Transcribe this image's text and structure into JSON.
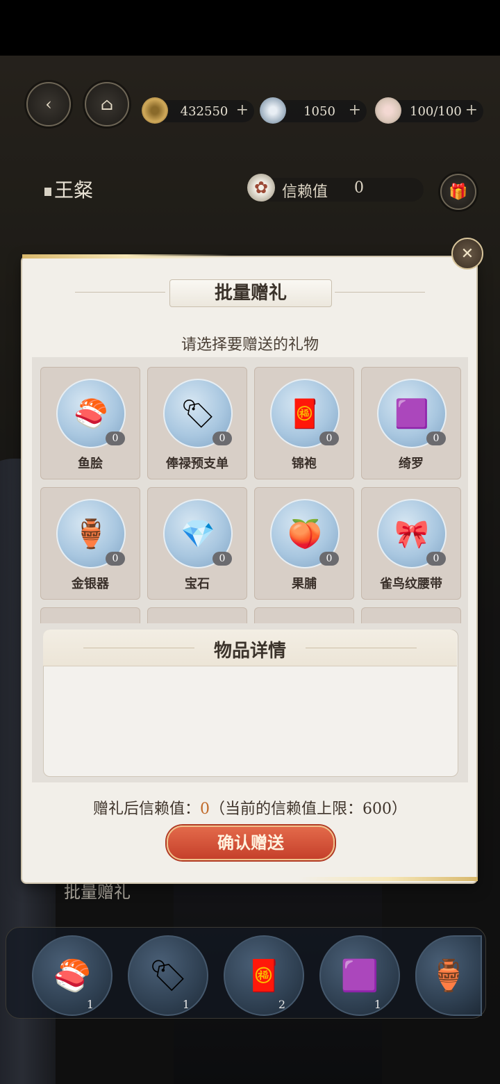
{
  "resources": [
    {
      "icon": "coin-icon",
      "value": "432550"
    },
    {
      "icon": "silver-icon",
      "value": "1050"
    },
    {
      "icon": "food-bowl-icon",
      "value": "100/100"
    }
  ],
  "plus_symbol": "+",
  "character": {
    "name": "王粲",
    "trust_label": "信赖值",
    "trust_value": "0"
  },
  "dialog": {
    "title": "批量赠礼",
    "subtitle": "请选择要赠送的礼物",
    "items": [
      {
        "name": "鱼脍",
        "count": "0",
        "icon": "fish-dish-icon",
        "glyph": "🍣"
      },
      {
        "name": "俸禄预支单",
        "count": "0",
        "icon": "wooden-tag-icon",
        "glyph": "🏷"
      },
      {
        "name": "锦袍",
        "count": "0",
        "icon": "red-robe-icon",
        "glyph": "🧧"
      },
      {
        "name": "绮罗",
        "count": "0",
        "icon": "silk-cloth-icon",
        "glyph": "🟪"
      },
      {
        "name": "金银器",
        "count": "0",
        "icon": "metal-ware-icon",
        "glyph": "🏺"
      },
      {
        "name": "宝石",
        "count": "0",
        "icon": "gem-box-icon",
        "glyph": "💎"
      },
      {
        "name": "果脯",
        "count": "0",
        "icon": "dried-fruit-icon",
        "glyph": "🍑"
      },
      {
        "name": "雀鸟纹腰带",
        "count": "0",
        "icon": "belt-icon",
        "glyph": "🎀"
      }
    ],
    "detail_title": "物品详情",
    "after_trust_prefix": "赠礼后信赖值：",
    "after_trust_value": "0",
    "after_trust_suffix": "（当前的信赖值上限：600）",
    "confirm_label": "确认赠送"
  },
  "bottom": {
    "tab_label": "批量赠礼",
    "slots": [
      {
        "icon": "fish-dish-icon",
        "glyph": "🍣",
        "count": "1"
      },
      {
        "icon": "wooden-tag-icon",
        "glyph": "🏷",
        "count": "1"
      },
      {
        "icon": "red-robe-icon",
        "glyph": "🧧",
        "count": "2"
      },
      {
        "icon": "silk-cloth-icon",
        "glyph": "🟪",
        "count": "1"
      },
      {
        "icon": "metal-ware-icon",
        "glyph": "🏺",
        "count": ""
      }
    ]
  },
  "colors": {
    "accent": "#c5402b",
    "highlight": "#c06a2a",
    "panel": "#f2efe9"
  }
}
